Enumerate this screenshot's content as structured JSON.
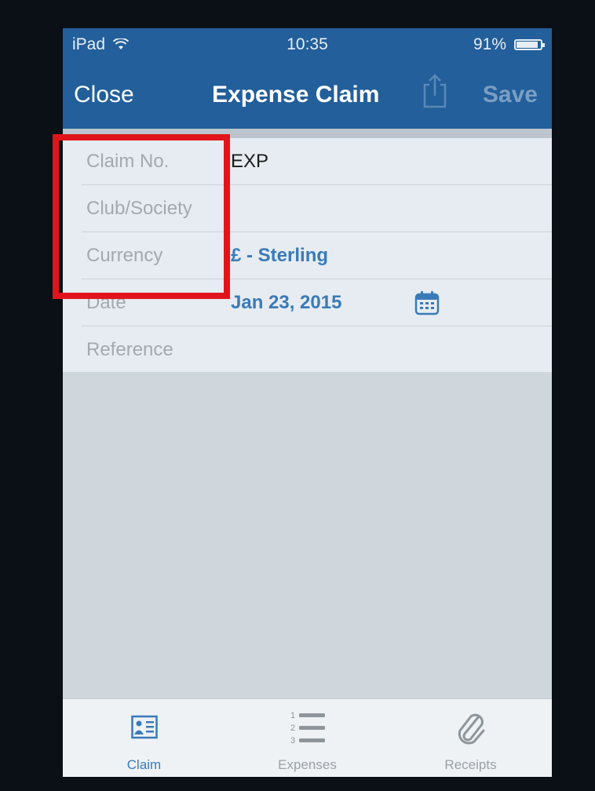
{
  "status_bar": {
    "carrier": "iPad",
    "time": "10:35",
    "battery": "91%",
    "battery_level": 0.91
  },
  "nav": {
    "close_label": "Close",
    "title": "Expense Claim",
    "save_label": "Save"
  },
  "form": {
    "rows": [
      {
        "label": "Claim No.",
        "value": "EXP"
      },
      {
        "label": "Club/Society",
        "value": ""
      },
      {
        "label": "Currency",
        "value": "£ - Sterling"
      },
      {
        "label": "Date",
        "value": "Jan 23, 2015"
      },
      {
        "label": "Reference",
        "value": ""
      }
    ]
  },
  "tabs": [
    {
      "label": "Claim",
      "icon": "id-card-icon",
      "active": true
    },
    {
      "label": "Expenses",
      "icon": "numbered-list-icon",
      "active": false
    },
    {
      "label": "Receipts",
      "icon": "paperclip-icon",
      "active": false
    }
  ],
  "colors": {
    "nav_background": "#225f9b",
    "accent": "#3a7ab8",
    "highlight_box": "#e2141b"
  }
}
